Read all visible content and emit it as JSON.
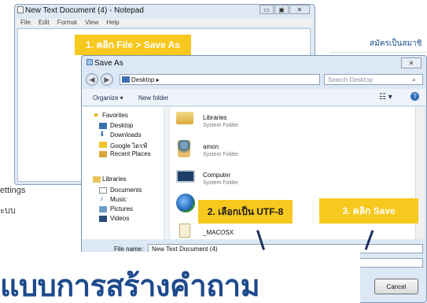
{
  "page": {
    "right_text": "สมัครเป็นสมาชิ",
    "side_text_1": "ettings",
    "side_text_2": "ะบบ",
    "heading": "แบบการสร้างคำถาม"
  },
  "notepad": {
    "title": "New Text Document (4) - Notepad",
    "menu": [
      "File",
      "Edit",
      "Format",
      "View",
      "Help"
    ],
    "btn_min": "▭",
    "btn_max": "▣",
    "btn_close": "✕"
  },
  "dialog": {
    "title": "Save As",
    "close": "✕",
    "address": "Desktop  ▸",
    "search_placeholder": "Search Desktop",
    "toolbar": {
      "organize": "Organize ▾",
      "new_folder": "New folder"
    },
    "nav": {
      "favorites_header": "Favorites",
      "favorites": [
        "Desktop",
        "Downloads",
        "Google ไดรฟ์",
        "Recent Places"
      ],
      "libraries_header": "Libraries",
      "libraries": [
        "Documents",
        "Music",
        "Pictures",
        "Videos"
      ]
    },
    "items": [
      {
        "name": "Libraries",
        "sub": "System Folder"
      },
      {
        "name": "amon",
        "sub": "System Folder"
      },
      {
        "name": "Computer",
        "sub": "System Folder"
      },
      {
        "name": "_MACOSX",
        "sub": ""
      }
    ],
    "file_name_label": "File name:",
    "file_name_value": "New Text Document (4)",
    "cancel": "Cancel"
  },
  "callouts": {
    "step1": "1. คลิก File > Save As",
    "step2": "2. เลือกเป็น UTF-8",
    "step3": "3. คลิก Save"
  },
  "colors": {
    "callout": "#f7c81d",
    "heading": "#1d4a8c"
  }
}
